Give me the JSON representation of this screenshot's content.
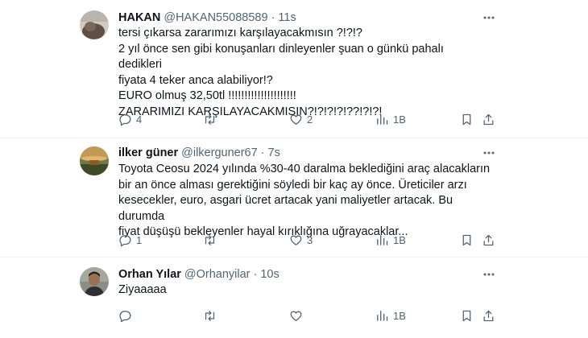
{
  "tweets": [
    {
      "name": "HAKAN",
      "handle": "@HAKAN55088589",
      "time": "11s",
      "text": "tersi çıkarsa zararımızı karşılayacakmısın ?!?!?\n2 yıl önce sen gibi konuşanları dinleyenler şuan o günkü pahalı dedikleri\nfiyata 4 teker anca alabiliyor!?\nEURO olmuş 32,50tl !!!!!!!!!!!!!!!!!!!!!\nZARARIMIZI KARŞILAYACAKMISIN?!?!?!?!??!?!?!",
      "replies": "4",
      "retweets": "",
      "likes": "2",
      "views": "1B"
    },
    {
      "name": "ilker güner",
      "handle": "@ilkerguner67",
      "time": "7s",
      "text": "Toyota Ceosu 2024 yılında %30-40 daralma beklediğini araç alacakların\nbir an önce alması gerektiğini söyledi bir kaç ay önce. Üreticiler arzı\nkesecekler, euro, asgari ücret artacak yani maliyetler artacak. Bu durumda\nfiyat düşüşü bekleyenler hayal kırıklığına uğrayacaklar...",
      "replies": "1",
      "retweets": "",
      "likes": "3",
      "views": "1B"
    },
    {
      "name": "Orhan Yılar",
      "handle": "@Orhanyilar",
      "time": "10s",
      "text": "Ziyaaaaa",
      "replies": "",
      "retweets": "",
      "likes": "",
      "views": "1B"
    }
  ],
  "icons": {
    "reply": "reply-icon",
    "retweet": "retweet-icon",
    "like": "like-icon",
    "views": "views-icon",
    "bookmark": "bookmark-icon",
    "share": "share-icon",
    "more": "more-icon"
  },
  "colors": {
    "text": "#0f1419",
    "secondary": "#536471",
    "divider": "#eff3f4"
  }
}
